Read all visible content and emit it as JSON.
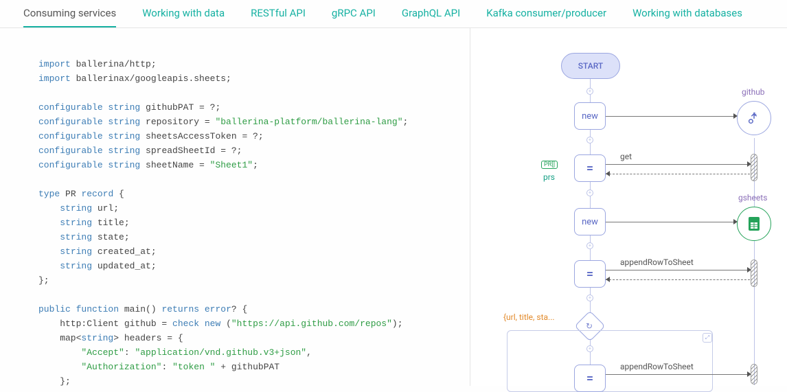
{
  "tabs": [
    {
      "label": "Consuming services",
      "active": true
    },
    {
      "label": "Working with data",
      "active": false
    },
    {
      "label": "RESTful API",
      "active": false
    },
    {
      "label": "gRPC API",
      "active": false
    },
    {
      "label": "GraphQL API",
      "active": false
    },
    {
      "label": "Kafka consumer/producer",
      "active": false
    },
    {
      "label": "Working with databases",
      "active": false
    }
  ],
  "code": {
    "l1_kw": "import",
    "l1_rest": " ballerina/http;",
    "l2_kw": "import",
    "l2_rest": " ballerinax/googleapis.sheets;",
    "l3_kw": "configurable string",
    "l3_rest": " githubPAT = ?;",
    "l4_kw": "configurable string",
    "l4_mid": " repository = ",
    "l4_str": "\"ballerina-platform/ballerina-lang\"",
    "l4_end": ";",
    "l5_kw": "configurable string",
    "l5_rest": " sheetsAccessToken = ?;",
    "l6_kw": "configurable string",
    "l6_rest": " spreadSheetId = ?;",
    "l7_kw": "configurable string",
    "l7_mid": " sheetName = ",
    "l7_str": "\"Sheet1\"",
    "l7_end": ";",
    "l8_kw": "type",
    "l8_mid": " PR ",
    "l8_kw2": "record",
    "l8_end": " {",
    "l9_kw": "string",
    "l9_rest": " url;",
    "l10_kw": "string",
    "l10_rest": " title;",
    "l11_kw": "string",
    "l11_rest": " state;",
    "l12_kw": "string",
    "l12_rest": " created_at;",
    "l13_kw": "string",
    "l13_rest": " updated_at;",
    "l14": "};",
    "l15_kw1": "public function",
    "l15_mid": " main() ",
    "l15_kw2": "returns error",
    "l15_end": "? {",
    "l16_a": "    http:Client github = ",
    "l16_kw": "check new",
    "l16_b": " (",
    "l16_str": "\"https://api.github.com/repos\"",
    "l16_c": ");",
    "l17_a": "    map<",
    "l17_kw": "string",
    "l17_b": "> headers = {",
    "l18_a": "        ",
    "l18_s1": "\"Accept\"",
    "l18_b": ": ",
    "l18_s2": "\"application/vnd.github.v3+json\"",
    "l18_c": ",",
    "l19_a": "        ",
    "l19_s1": "\"Authorization\"",
    "l19_b": ": ",
    "l19_s2": "\"token \"",
    "l19_c": " + githubPAT",
    "l20": "    };"
  },
  "diagram": {
    "start": "START",
    "new1": "new",
    "new2": "new",
    "eq": "=",
    "github_label": "github",
    "gsheets_label": "gsheets",
    "get_label": "get",
    "append_label": "appendRowToSheet",
    "append_label2": "appendRowToSheet",
    "prs_badge": "PR[]",
    "prs_label": "prs",
    "loop_label": "{url, title, sta..."
  }
}
